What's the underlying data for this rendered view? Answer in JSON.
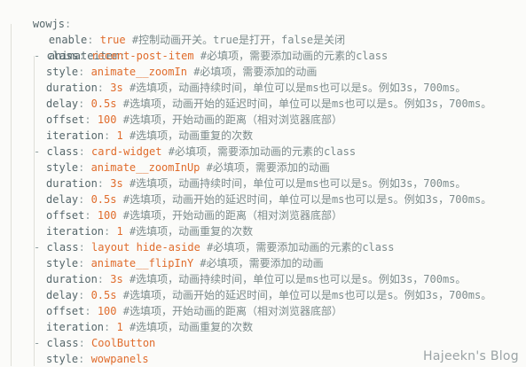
{
  "yaml": {
    "root_key": "wowjs",
    "enable": {
      "key": "enable",
      "value": "true",
      "comment": "#控制动画开关。true是打开，false是关闭"
    },
    "list_key": "animateitem",
    "items": [
      {
        "class": "recent-post-item",
        "class_comment": "#必填项，需要添加动画的元素的class",
        "style": "animate__zoomIn",
        "style_comment": "#必填项，需要添加的动画",
        "duration": "3s",
        "duration_comment": "#选填项，动画持续时间，单位可以是ms也可以是s。例如3s，700ms。",
        "delay": "0.5s",
        "delay_comment": "#选填项，动画开始的延迟时间，单位可以是ms也可以是s。例如3s，700ms。",
        "offset": "100",
        "offset_comment": "#选填项，开始动画的距离（相对浏览器底部）",
        "iteration": "1",
        "iteration_comment": "#选填项，动画重复的次数"
      },
      {
        "class": "card-widget",
        "class_comment": "#必填项，需要添加动画的元素的class",
        "style": "animate__zoomInUp",
        "style_comment": "#必填项，需要添加的动画",
        "duration": "3s",
        "duration_comment": "#选填项，动画持续时间，单位可以是ms也可以是s。例如3s，700ms。",
        "delay": "0.5s",
        "delay_comment": "#选填项，动画开始的延迟时间，单位可以是ms也可以是s。例如3s，700ms。",
        "offset": "100",
        "offset_comment": "#选填项，开始动画的距离（相对浏览器底部）",
        "iteration": "1",
        "iteration_comment": "#选填项，动画重复的次数"
      },
      {
        "class": "layout hide-aside",
        "class_comment": "#必填项，需要添加动画的元素的class",
        "style": "animate__flipInY",
        "style_comment": "#必填项，需要添加的动画",
        "duration": "3s",
        "duration_comment": "#选填项，动画持续时间，单位可以是ms也可以是s。例如3s，700ms。",
        "delay": "0.5s",
        "delay_comment": "#选填项，动画开始的延迟时间，单位可以是ms也可以是s。例如3s，700ms。",
        "offset": "100",
        "offset_comment": "#选填项，开始动画的距离（相对浏览器底部）",
        "iteration": "1",
        "iteration_comment": "#选填项，动画重复的次数"
      },
      {
        "class": "CoolButton",
        "style": "wowpanels"
      }
    ]
  },
  "watermark": "Hajeekn's Blog",
  "colors": {
    "background": "#fbfbf9",
    "key": "#56676b",
    "value": "#e06c2c",
    "comment": "#7d8c8d",
    "indent_guide": "#dedfd8"
  }
}
